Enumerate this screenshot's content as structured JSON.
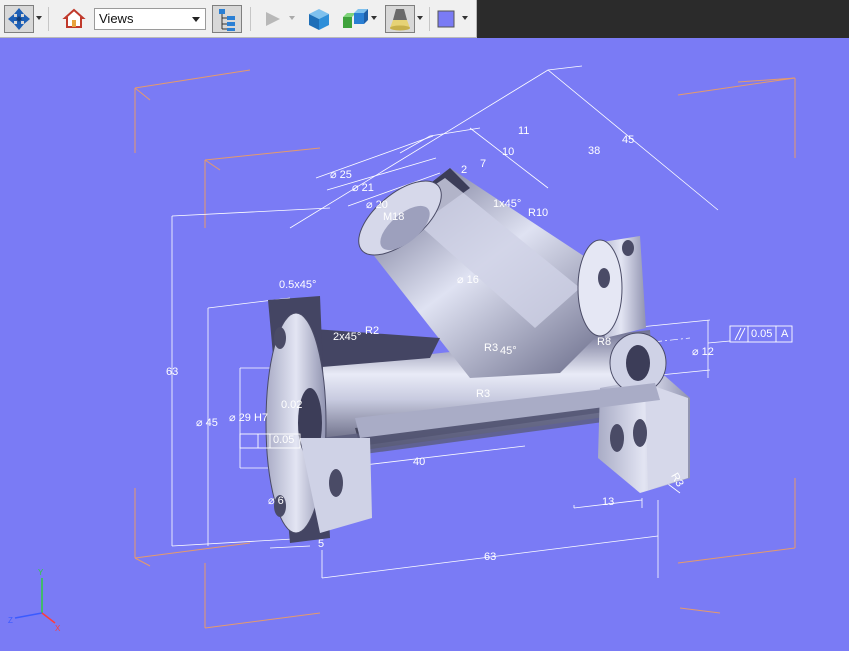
{
  "toolbar": {
    "views_select_value": "Views",
    "views_select_options": [
      "Views"
    ]
  },
  "viewport": {
    "background_color": "#7a7bf5",
    "dimensions": {
      "d63_left": "63",
      "d45_top": "45",
      "d38": "38",
      "d11": "11",
      "d10": "10",
      "d7": "7",
      "d2": "2",
      "d25": "⌀ 25",
      "d21": "⌀ 21",
      "d20": "⌀ 20",
      "m18": "M18",
      "chamfer_1x45": "1x45°",
      "r10": "R10",
      "d16": "⌀ 16",
      "chamfer_05x45": "0.5x45°",
      "chamfer_2x45": "2x45°",
      "r2": "R2",
      "r3_upper": "R3",
      "angle_45": "45°",
      "r8": "R8",
      "r3_lower": "R3",
      "d12": "⌀ 12",
      "parallel_tol": "0.05",
      "datum_a": "A",
      "d45_left": "⌀ 45",
      "d29h7": "⌀ 29 H7",
      "tol_002": "0.02",
      "box_005": "0.05",
      "d40": "40",
      "d6": "⌀ 6",
      "d5": "5",
      "d13": "13",
      "d63_bottom": "63",
      "r3_corner": "R3"
    }
  }
}
